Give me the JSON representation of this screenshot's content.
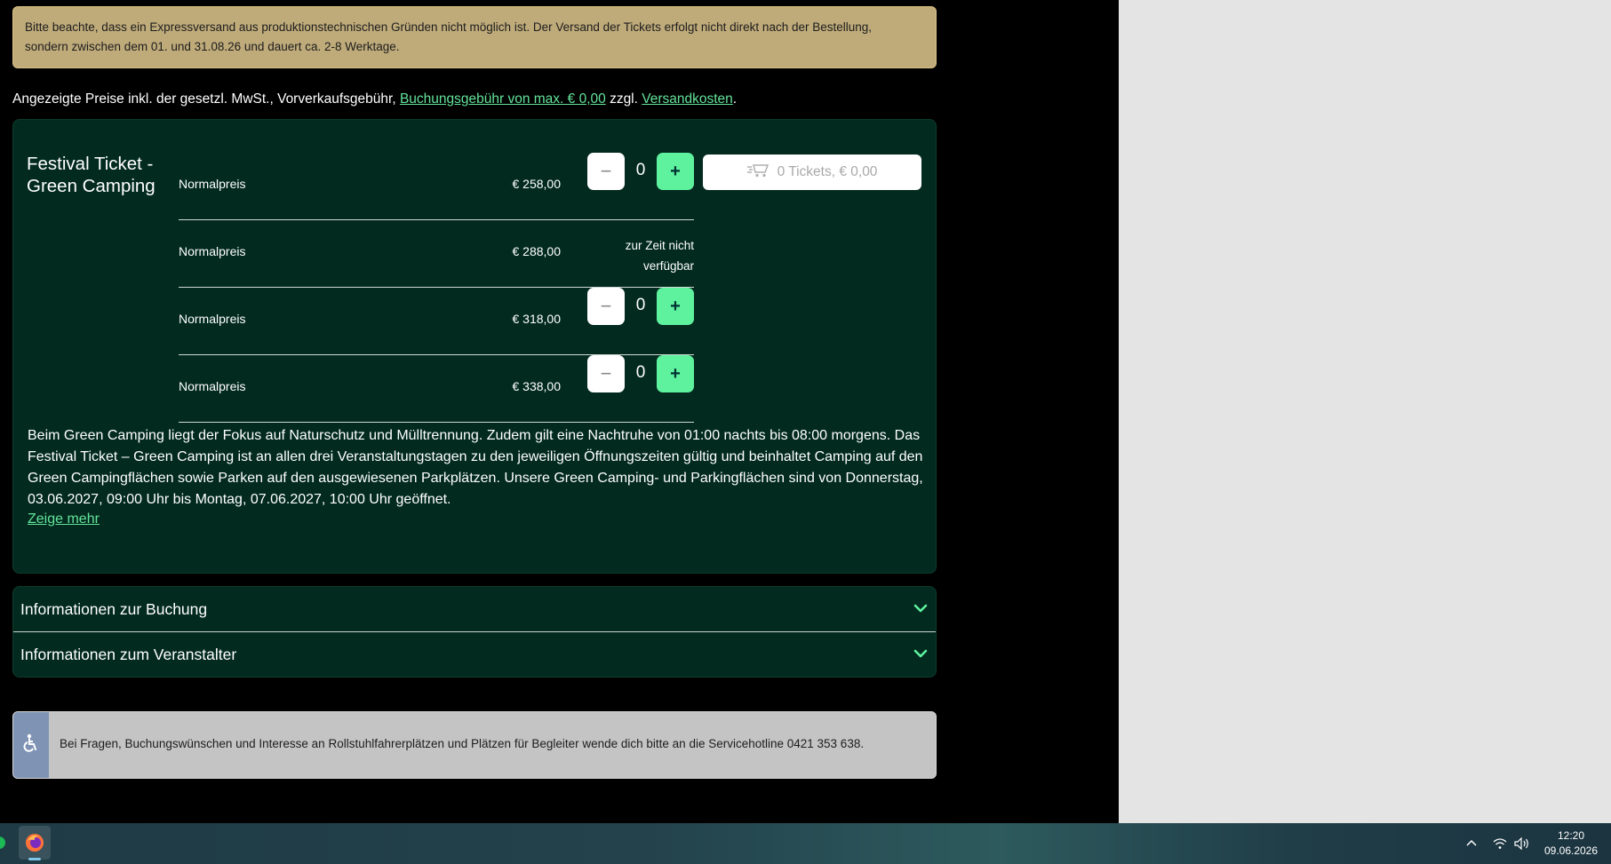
{
  "notice": {
    "line1": "Bitte beachte, dass ein Expressversand aus produktionstechnischen Gründen nicht möglich ist. Der Versand der Tickets erfolgt nicht direkt nach der Bestellung,",
    "line2": "sondern zwischen dem 01. und 31.08.26 und dauert ca. 2-8 Werktage."
  },
  "price_info": {
    "prefix": "Angezeigte Preise inkl. der gesetzl. MwSt., Vorverkaufsgebühr,",
    "booking_fee_link": "Buchungsgebühr von max. € 0,00",
    "middle": "zzgl.",
    "shipping_link": "Versandkosten",
    "suffix": "."
  },
  "ticket": {
    "name": "Festival Ticket - Green Camping",
    "rows": [
      {
        "label": "Normalpreis",
        "price": "€ 258,00",
        "qty": "0",
        "available": true
      },
      {
        "label": "Normalpreis",
        "price": "€ 288,00",
        "unavailable_text": "zur Zeit nicht verfügbar",
        "available": false
      },
      {
        "label": "Normalpreis",
        "price": "€ 318,00",
        "qty": "0",
        "available": true
      },
      {
        "label": "Normalpreis",
        "price": "€ 338,00",
        "qty": "0",
        "available": true
      }
    ],
    "minus_symbol": "−",
    "plus_symbol": "+",
    "cart_label": "0 Tickets, € 0,00",
    "description": "Beim Green Camping liegt der Fokus auf Naturschutz und Mülltrennung. Zudem gilt eine Nachtruhe von 01:00 nachts bis 08:00 morgens. Das Festival Ticket – Green Camping ist an allen drei Veranstaltungstagen zu den jeweiligen Öffnungszeiten gültig und beinhaltet Camping auf den Green Campingflächen sowie Parken auf den ausgewiesenen Parkplätzen. Unsere Green Camping- und Parkingflächen sind von Donnerstag, 03.06.2027, 09:00 Uhr bis Montag, 07.06.2027, 10:00 Uhr geöffnet.",
    "show_more": "Zeige mehr"
  },
  "accordion": {
    "booking_info": "Informationen zur Buchung",
    "organizer_info": "Informationen zum Veranstalter"
  },
  "accessibility": {
    "text": "Bei Fragen, Buchungswünschen und Interesse an Rollstuhlfahrerplätzen und Plätzen für Begleiter wende dich bitte an die Servicehotline 0421 353 638."
  },
  "taskbar": {
    "time": "12:20",
    "date": "09.06.2026",
    "icons": [
      "spotify-icon",
      "firefox-icon",
      "chevron-up-icon",
      "wifi-icon",
      "volume-icon"
    ]
  },
  "colors": {
    "accent_green": "#5ef29e",
    "link_green": "#63e39a",
    "card_bg": "#022a1f",
    "notice_bg": "#bfab7a",
    "accessibility_side": "#7f93b5"
  }
}
